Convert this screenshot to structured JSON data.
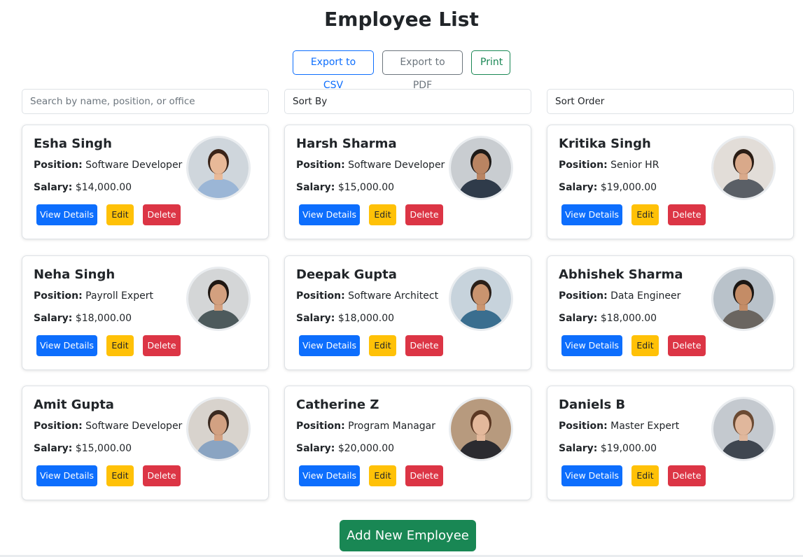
{
  "page": {
    "title": "Employee List"
  },
  "toolbar": {
    "export_csv": "Export to CSV",
    "export_pdf": "Export to PDF",
    "print": "Print"
  },
  "filters": {
    "search_placeholder": "Search by name, position, or office",
    "sort_by": "Sort By",
    "sort_order": "Sort Order"
  },
  "card_labels": {
    "position": "Position:",
    "salary": "Salary:",
    "view": "View Details",
    "edit": "Edit",
    "delete": "Delete"
  },
  "employees": [
    {
      "name": "Esha Singh",
      "position": "Software Developer",
      "salary": "$14,000.00",
      "avatar": {
        "bg": "#cfd6dc",
        "skin": "#e8b998",
        "hair": "#3a2418",
        "shirt": "#9bb6d6"
      }
    },
    {
      "name": "Harsh Sharma",
      "position": "Software Developer",
      "salary": "$15,000.00",
      "avatar": {
        "bg": "#c9cdd1",
        "skin": "#b98462",
        "hair": "#1e1a17",
        "shirt": "#2f3b4a"
      }
    },
    {
      "name": "Kritika Singh",
      "position": "Senior HR",
      "salary": "$19,000.00",
      "avatar": {
        "bg": "#e2ddd8",
        "skin": "#d9a98a",
        "hair": "#2b1d15",
        "shirt": "#5a5f66"
      }
    },
    {
      "name": "Neha Singh",
      "position": "Payroll Expert",
      "salary": "$18,000.00",
      "avatar": {
        "bg": "#d4d6d7",
        "skin": "#d3a07f",
        "hair": "#1f1712",
        "shirt": "#4d5a5c"
      }
    },
    {
      "name": "Deepak Gupta",
      "position": "Software Architect",
      "salary": "$18,000.00",
      "avatar": {
        "bg": "#c7d3dc",
        "skin": "#c9946f",
        "hair": "#2a1f18",
        "shirt": "#3a6e8f"
      }
    },
    {
      "name": "Abhishek Sharma",
      "position": "Data Engineer",
      "salary": "$18,000.00",
      "avatar": {
        "bg": "#b9c2ca",
        "skin": "#c48c66",
        "hair": "#1b1613",
        "shirt": "#6a6560"
      }
    },
    {
      "name": "Amit Gupta",
      "position": "Software Developer",
      "salary": "$15,000.00",
      "avatar": {
        "bg": "#d8d3cd",
        "skin": "#d2a182",
        "hair": "#3b2a20",
        "shirt": "#8aa4c2"
      }
    },
    {
      "name": "Catherine Z",
      "position": "Program Managar",
      "salary": "$20,000.00",
      "avatar": {
        "bg": "#b79a7e",
        "skin": "#e3b89b",
        "hair": "#5b3823",
        "shirt": "#2b2b30"
      }
    },
    {
      "name": "Daniels B",
      "position": "Master Expert",
      "salary": "$19,000.00",
      "avatar": {
        "bg": "#c4c9cf",
        "skin": "#e0b79c",
        "hair": "#6b4a33",
        "shirt": "#3f4650"
      }
    }
  ],
  "actions": {
    "add_employee": "Add New Employee"
  }
}
